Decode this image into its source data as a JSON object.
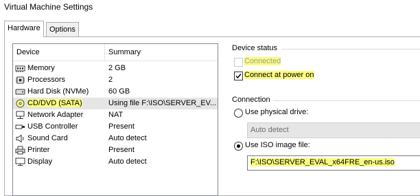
{
  "window": {
    "title": "Virtual Machine Settings"
  },
  "tabs": [
    {
      "label": "Hardware",
      "active": true
    },
    {
      "label": "Options",
      "active": false
    }
  ],
  "device_list": {
    "columns": {
      "device": "Device",
      "summary": "Summary"
    },
    "rows": [
      {
        "device": "Memory",
        "summary": "2 GB",
        "icon": "memory-icon"
      },
      {
        "device": "Processors",
        "summary": "2",
        "icon": "processor-icon"
      },
      {
        "device": "Hard Disk (NVMe)",
        "summary": "60 GB",
        "icon": "hard-disk-icon"
      },
      {
        "device": "CD/DVD (SATA)",
        "summary": "Using file F:\\ISO\\SERVER_EV...",
        "icon": "cd-dvd-icon",
        "selected": true
      },
      {
        "device": "Network Adapter",
        "summary": "NAT",
        "icon": "network-adapter-icon"
      },
      {
        "device": "USB Controller",
        "summary": "Present",
        "icon": "usb-controller-icon"
      },
      {
        "device": "Sound Card",
        "summary": "Auto detect",
        "icon": "sound-card-icon"
      },
      {
        "device": "Printer",
        "summary": "Present",
        "icon": "printer-icon"
      },
      {
        "device": "Display",
        "summary": "Auto detect",
        "icon": "display-icon"
      }
    ]
  },
  "device_status": {
    "label": "Device status",
    "connected": {
      "label": "Connected",
      "checked": false,
      "enabled": false
    },
    "connect_at_power_on": {
      "label": "Connect at power on",
      "checked": true,
      "enabled": true
    }
  },
  "connection": {
    "label": "Connection",
    "physical_drive": {
      "label": "Use physical drive:",
      "selected": false
    },
    "physical_drive_select": {
      "value": "Auto detect"
    },
    "iso_image": {
      "label": "Use ISO image file:",
      "selected": true
    },
    "iso_path": {
      "value": "F:\\ISO\\SERVER_EVAL_x64FRE_en-us.iso"
    }
  },
  "colors": {
    "highlight": "#fbfb7f",
    "selection": "#e5e5e5"
  }
}
